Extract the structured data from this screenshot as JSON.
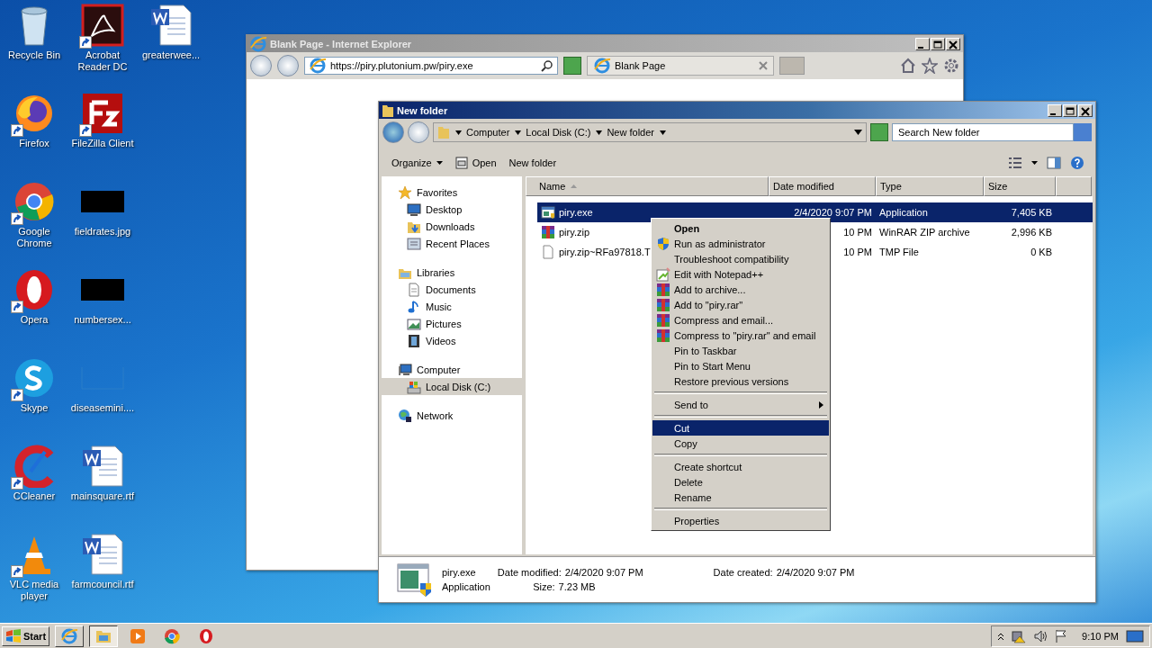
{
  "desktop_icons": [
    {
      "label": "Recycle Bin",
      "kind": "recycle",
      "shortcut": false
    },
    {
      "label": "Firefox",
      "kind": "firefox",
      "shortcut": true
    },
    {
      "label": "Google Chrome",
      "kind": "chrome",
      "shortcut": true
    },
    {
      "label": "Opera",
      "kind": "opera",
      "shortcut": true
    },
    {
      "label": "Skype",
      "kind": "skype",
      "shortcut": true
    },
    {
      "label": "CCleaner",
      "kind": "ccleaner",
      "shortcut": true
    },
    {
      "label": "VLC media player",
      "kind": "vlc",
      "shortcut": true
    },
    {
      "label": "Acrobat Reader DC",
      "kind": "pdf",
      "shortcut": true
    },
    {
      "label": "FileZilla Client",
      "kind": "filezilla",
      "shortcut": true
    },
    {
      "label": "fieldrates.jpg",
      "kind": "thumb-dark",
      "shortcut": false
    },
    {
      "label": "numbersex...",
      "kind": "thumb-dark",
      "shortcut": false
    },
    {
      "label": "diseasemini....",
      "kind": "thumb-blank",
      "shortcut": false
    },
    {
      "label": "mainsquare.rtf",
      "kind": "word",
      "shortcut": false
    },
    {
      "label": "farmcouncil.rtf",
      "kind": "word",
      "shortcut": false
    },
    {
      "label": "greaterwee...",
      "kind": "word",
      "shortcut": false
    }
  ],
  "ie_window": {
    "title": "Blank Page - Internet Explorer",
    "address": "https://piry.plutonium.pw/piry.exe",
    "tab": "Blank Page"
  },
  "explorer": {
    "title": "New folder",
    "breadcrumb": [
      "Computer",
      "Local Disk (C:)",
      "New folder"
    ],
    "search": {
      "placeholder": "Search New folder"
    },
    "toolbar": [
      {
        "label": "Organize",
        "kind": "menu"
      },
      {
        "label": "Open",
        "kind": "open"
      },
      {
        "label": "New folder",
        "kind": "plain"
      }
    ],
    "nav": [
      {
        "label": "Favorites",
        "kind": "star",
        "selected": false,
        "children": [
          {
            "label": "Desktop",
            "kind": "desktop",
            "selected": false
          },
          {
            "label": "Downloads",
            "kind": "downloads",
            "selected": false
          },
          {
            "label": "Recent Places",
            "kind": "recent",
            "selected": false
          }
        ]
      },
      {
        "label": "Libraries",
        "kind": "library",
        "selected": false,
        "children": [
          {
            "label": "Documents",
            "kind": "documents",
            "selected": false
          },
          {
            "label": "Music",
            "kind": "music",
            "selected": false
          },
          {
            "label": "Pictures",
            "kind": "pictures",
            "selected": false
          },
          {
            "label": "Videos",
            "kind": "videos",
            "selected": false
          }
        ]
      },
      {
        "label": "Computer",
        "kind": "computer",
        "selected": false,
        "children": [
          {
            "label": "Local Disk (C:)",
            "kind": "disk",
            "selected": true
          }
        ]
      },
      {
        "label": "Network",
        "kind": "network",
        "selected": false
      }
    ],
    "columns": [
      "Name",
      "Date modified",
      "Type",
      "Size"
    ],
    "rows": [
      {
        "name": "piry.exe",
        "kind": "exe",
        "date": "2/4/2020 9:07 PM",
        "type": "Application",
        "size": "7,405 KB",
        "selected": true
      },
      {
        "name": "piry.zip",
        "kind": "rar",
        "date": "10 PM",
        "type": "WinRAR ZIP archive",
        "size": "2,996 KB",
        "selected": false
      },
      {
        "name": "piry.zip~RFa97818.T",
        "kind": "blank",
        "date": "10 PM",
        "type": "TMP File",
        "size": "0 KB",
        "selected": false
      }
    ],
    "details": {
      "name": "piry.exe",
      "type": "Application",
      "fields": [
        {
          "label": "Date modified:",
          "value": "2/4/2020 9:07 PM"
        },
        {
          "label": "Size:",
          "value": "7.23 MB"
        },
        {
          "label": "Date created:",
          "value": "2/4/2020 9:07 PM"
        }
      ]
    }
  },
  "context_menu": [
    {
      "kind": "plain",
      "label": "Open",
      "default": true,
      "selected": false,
      "submenu": false
    },
    {
      "kind": "shield",
      "label": "Run as administrator",
      "default": false,
      "selected": false,
      "submenu": false
    },
    {
      "kind": "plain",
      "label": "Troubleshoot compatibility",
      "default": false,
      "selected": false,
      "submenu": false
    },
    {
      "kind": "notepad",
      "label": "Edit with Notepad++",
      "default": false,
      "selected": false,
      "submenu": false
    },
    {
      "kind": "rar",
      "label": "Add to archive...",
      "default": false,
      "selected": false,
      "submenu": false
    },
    {
      "kind": "rar",
      "label": "Add to \"piry.rar\"",
      "default": false,
      "selected": false,
      "submenu": false
    },
    {
      "kind": "rar",
      "label": "Compress and email...",
      "default": false,
      "selected": false,
      "submenu": false
    },
    {
      "kind": "rar",
      "label": "Compress to \"piry.rar\" and email",
      "default": false,
      "selected": false,
      "submenu": false
    },
    {
      "kind": "plain",
      "label": "Pin to Taskbar",
      "default": false,
      "selected": false,
      "submenu": false
    },
    {
      "kind": "plain",
      "label": "Pin to Start Menu",
      "default": false,
      "selected": false,
      "submenu": false
    },
    {
      "kind": "plain",
      "label": "Restore previous versions",
      "default": false,
      "selected": false,
      "submenu": false
    },
    {
      "kind": "separator"
    },
    {
      "kind": "plain",
      "label": "Send to",
      "default": false,
      "selected": false,
      "submenu": true
    },
    {
      "kind": "separator"
    },
    {
      "kind": "plain",
      "label": "Cut",
      "default": false,
      "selected": true,
      "submenu": false
    },
    {
      "kind": "plain",
      "label": "Copy",
      "default": false,
      "selected": false,
      "submenu": false
    },
    {
      "kind": "separator"
    },
    {
      "kind": "plain",
      "label": "Create shortcut",
      "default": false,
      "selected": false,
      "submenu": false
    },
    {
      "kind": "plain",
      "label": "Delete",
      "default": false,
      "selected": false,
      "submenu": false
    },
    {
      "kind": "plain",
      "label": "Rename",
      "default": false,
      "selected": false,
      "submenu": false
    },
    {
      "kind": "separator"
    },
    {
      "kind": "plain",
      "label": "Properties",
      "default": false,
      "selected": false,
      "submenu": false
    }
  ],
  "taskbar": {
    "start": "Start",
    "buttons": [
      {
        "kind": "ie",
        "selected": false
      },
      {
        "kind": "explorer",
        "selected": true
      },
      {
        "kind": "media",
        "selected": false
      },
      {
        "kind": "chrome",
        "selected": false
      },
      {
        "kind": "opera",
        "selected": false
      }
    ],
    "time": "9:10 PM"
  }
}
